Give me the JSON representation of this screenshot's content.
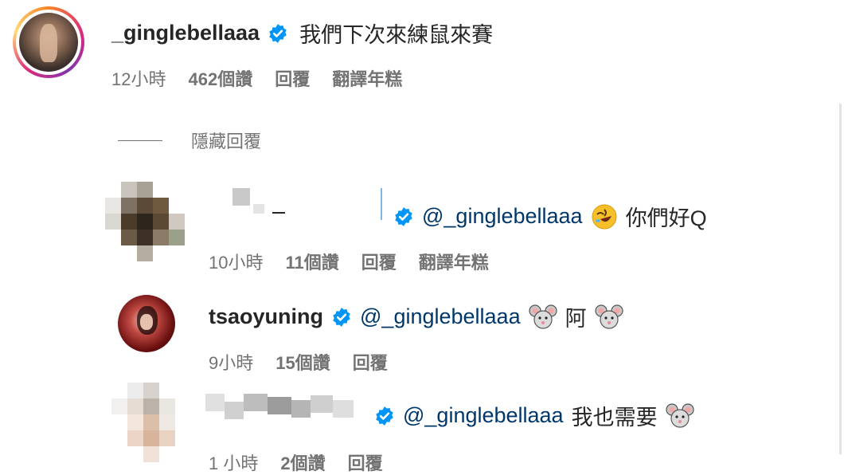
{
  "comments": [
    {
      "username": "_ginglebellaaa",
      "text": "我們下次來練鼠來賽",
      "time": "12小時",
      "likes": "462個讚",
      "reply": "回覆",
      "translate": "翻譯年糕"
    }
  ],
  "hide_replies": "隱藏回覆",
  "replies": [
    {
      "mention": "@_ginglebellaaa",
      "text": "你們好Q",
      "emoji_icon": "rolling-laughing-emoji-icon",
      "time": "10小時",
      "likes": "11個讚",
      "reply": "回覆",
      "translate": "翻譯年糕"
    },
    {
      "username": "tsaoyuning",
      "mention": "@_ginglebellaaa",
      "text": "阿",
      "emoji_icon": "mouse-face-emoji-icon",
      "time": "9小時",
      "likes": "15個讚",
      "reply": "回覆"
    },
    {
      "mention": "@_ginglebellaaa",
      "text": "我也需要",
      "emoji_icon": "mouse-face-emoji-icon",
      "time": "1 小時",
      "likes": "2個讚",
      "reply": "回覆"
    }
  ],
  "colors": {
    "verified": "#0095f6",
    "mention": "#00376b",
    "meta": "#737373"
  }
}
